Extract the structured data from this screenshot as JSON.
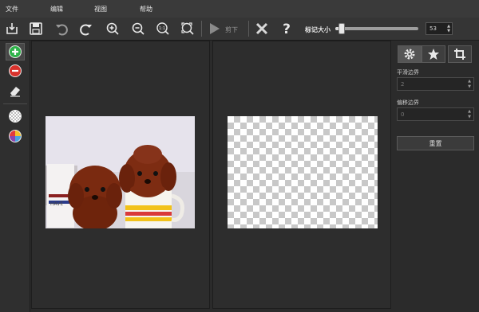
{
  "menu": {
    "file": "文件",
    "edit": "编辑",
    "view": "视图",
    "help": "帮助"
  },
  "toolbar": {
    "cut_label": "剪下",
    "mark_size_label": "标记大小",
    "mark_size_value": "53",
    "mark_size_fraction": 0.08,
    "icons": [
      "import-icon",
      "save-icon",
      "undo-icon",
      "redo-icon",
      "zoom-in-icon",
      "zoom-out-icon",
      "zoom-1to1-icon",
      "zoom-fit-icon",
      "play-icon",
      "close-icon",
      "help-icon"
    ]
  },
  "leftbar": {
    "icons": [
      "add-mark-icon",
      "remove-mark-icon",
      "eraser-icon",
      "transparency-icon",
      "color-wheel-icon"
    ]
  },
  "right": {
    "tabs": [
      "gear-icon",
      "star-icon",
      "crop-icon"
    ],
    "smooth_edge_label": "平滑边界",
    "smooth_edge_value": "2",
    "offset_edge_label": "偏移边界",
    "offset_edge_value": "0",
    "reset_label": "重置"
  },
  "colors": {
    "add": "#2fb34a",
    "remove": "#d9322c",
    "panel_bg": "#2d2d2d"
  }
}
